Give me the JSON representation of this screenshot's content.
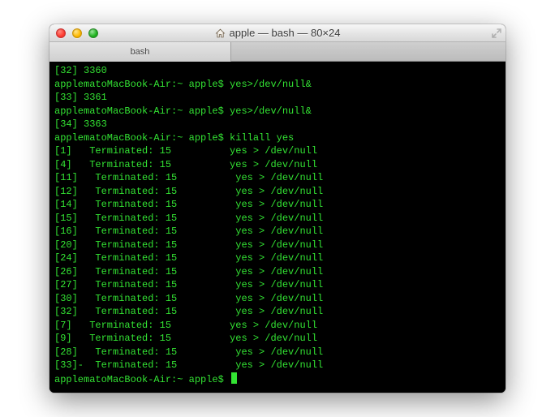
{
  "window": {
    "title": "apple — bash — 80×24"
  },
  "tabbar": {
    "tab1": "bash"
  },
  "terminal": {
    "l0": "[32] 3360",
    "l1": "applematoMacBook-Air:~ apple$ yes>/dev/null&",
    "l2": "[33] 3361",
    "l3": "applematoMacBook-Air:~ apple$ yes>/dev/null&",
    "l4": "[34] 3363",
    "l5": "applematoMacBook-Air:~ apple$ killall yes",
    "l6": "[1]   Terminated: 15          yes > /dev/null",
    "l7": "[4]   Terminated: 15          yes > /dev/null",
    "l8": "[11]   Terminated: 15          yes > /dev/null",
    "l9": "[12]   Terminated: 15          yes > /dev/null",
    "l10": "[14]   Terminated: 15          yes > /dev/null",
    "l11": "[15]   Terminated: 15          yes > /dev/null",
    "l12": "[16]   Terminated: 15          yes > /dev/null",
    "l13": "[20]   Terminated: 15          yes > /dev/null",
    "l14": "[24]   Terminated: 15          yes > /dev/null",
    "l15": "[26]   Terminated: 15          yes > /dev/null",
    "l16": "[27]   Terminated: 15          yes > /dev/null",
    "l17": "[30]   Terminated: 15          yes > /dev/null",
    "l18": "[32]   Terminated: 15          yes > /dev/null",
    "l19": "[7]   Terminated: 15          yes > /dev/null",
    "l20": "[9]   Terminated: 15          yes > /dev/null",
    "l21": "[28]   Terminated: 15          yes > /dev/null",
    "l22": "[33]-  Terminated: 15          yes > /dev/null",
    "prompt": "applematoMacBook-Air:~ apple$ "
  }
}
